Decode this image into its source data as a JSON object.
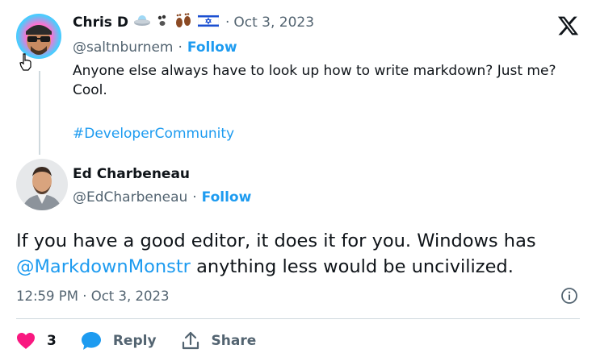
{
  "quoted": {
    "name": "Chris D",
    "timestamp": "Oct 3, 2023",
    "handle": "@saltnburnem",
    "follow_label": "Follow",
    "body": "Anyone else always have to look up how to write markdown? Just me? Cool.",
    "hashtag": "#DeveloperCommunity",
    "name_emojis": [
      "ufo",
      "paw-prints",
      "footprints",
      "israel-flag"
    ]
  },
  "reply": {
    "name": "Ed Charbeneau",
    "handle": "@EdCharbeneau",
    "follow_label": "Follow",
    "text_before": "If you have a good editor, it does it for you. Windows has ",
    "mention": "@MarkdownMonstr",
    "text_after": " anything less would be uncivilized.",
    "timestamp": "12:59 PM · Oct 3, 2023"
  },
  "actions": {
    "likes": "3",
    "reply_label": "Reply",
    "share_label": "Share"
  },
  "separator": "·",
  "colors": {
    "like": "#f91880",
    "reply": "#1d9bf0",
    "link": "#1d9bf0",
    "muted": "#536471"
  }
}
